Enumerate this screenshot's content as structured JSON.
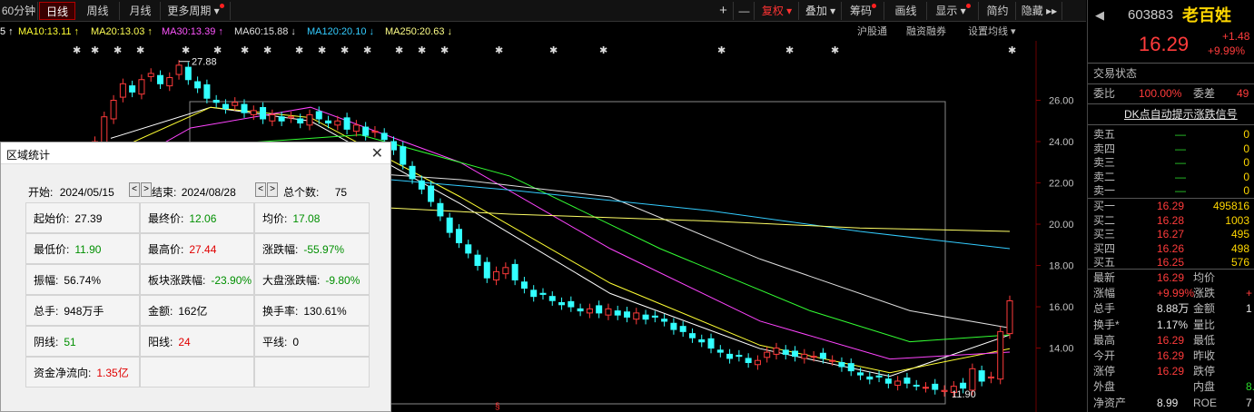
{
  "toolbar": {
    "left": [
      {
        "label": "60分钟",
        "active": false
      },
      {
        "label": "日线",
        "active": true
      },
      {
        "label": "周线",
        "active": false
      },
      {
        "label": "月线",
        "active": false
      },
      {
        "label": "更多周期 ▾",
        "active": false
      }
    ],
    "right": [
      {
        "label": "+",
        "dot": false,
        "red": false
      },
      {
        "label": "—",
        "dot": false,
        "red": false
      },
      {
        "label": "复权 ▾",
        "dot": false,
        "red": true
      },
      {
        "label": "叠加 ▾",
        "dot": false,
        "red": false
      },
      {
        "label": "筹码",
        "dot": true,
        "red": false
      },
      {
        "label": "画线",
        "dot": false,
        "red": false
      },
      {
        "label": "显示 ▾",
        "dot": true,
        "red": false
      },
      {
        "label": "简约",
        "dot": false,
        "red": false
      },
      {
        "label": "隐藏 ▸▸",
        "dot": false,
        "red": false
      }
    ]
  },
  "ma": {
    "ma5": "5 ↑",
    "ma10": "MA10:13.11 ↑",
    "ma20": "MA20:13.03 ↑",
    "ma30": "MA30:13.39 ↑",
    "ma60": "MA60:15.88 ↓",
    "ma120": "MA120:20.10 ↓",
    "ma250": "MA250:20.63 ↓",
    "links": [
      "沪股通",
      "融资融券",
      "设置均线 ▾"
    ],
    "colors": {
      "ma5": "#ffffff",
      "ma10": "#ffff33",
      "ma20": "#ff44ff",
      "ma30": "#33ff33",
      "ma60": "#e0e0e0",
      "ma120": "#33ccff",
      "ma250": "#ffff66"
    }
  },
  "chart_data": {
    "type": "candlestick",
    "y_axis_ticks": [
      "26.00",
      "24.00",
      "22.00",
      "20.00",
      "18.00",
      "16.00",
      "14.00"
    ],
    "ylim": [
      11.3,
      28.0
    ],
    "annotations": {
      "high_label": "27.88",
      "low_label": "11.90"
    },
    "up_color": "#ff3b3b",
    "down_color": "#33ffff",
    "closes": [
      20.9,
      21.2,
      21.0,
      21.5,
      21.8,
      21.6,
      22.0,
      22.6,
      23.2,
      24.0,
      25.2,
      26.0,
      26.8,
      26.4,
      27.0,
      27.3,
      26.8,
      27.1,
      27.7,
      27.0,
      26.6,
      26.1,
      25.9,
      25.6,
      25.9,
      25.4,
      25.5,
      25.1,
      25.3,
      25.0,
      25.2,
      24.9,
      25.3,
      25.1,
      24.9,
      25.0,
      24.6,
      24.8,
      24.3,
      24.5,
      24.1,
      23.6,
      22.9,
      22.2,
      21.7,
      21.1,
      20.4,
      19.6,
      19.1,
      18.6,
      18.0,
      17.4,
      17.7,
      17.9,
      17.3,
      16.9,
      16.5,
      16.6,
      16.3,
      16.1,
      16.0,
      15.8,
      15.9,
      15.7,
      15.9,
      15.6,
      15.5,
      15.7,
      15.4,
      15.5,
      15.3,
      14.9,
      14.8,
      14.5,
      14.3,
      14.0,
      13.8,
      13.5,
      13.6,
      13.3,
      13.4,
      13.8,
      14.0,
      13.7,
      13.6,
      13.7,
      13.6,
      13.5,
      13.4,
      13.1,
      12.9,
      12.7,
      12.5,
      12.6,
      12.3,
      12.4,
      12.3,
      12.2,
      12.1,
      12.0,
      11.95,
      12.15,
      12.06,
      13.0,
      12.4,
      12.6,
      14.8,
      16.29
    ],
    "ma_lines": {
      "ma5": [
        [
          0.1,
          0.23
        ],
        [
          0.2,
          0.14
        ],
        [
          0.3,
          0.18
        ],
        [
          0.45,
          0.42
        ],
        [
          0.6,
          0.68
        ],
        [
          0.75,
          0.84
        ],
        [
          0.88,
          0.92
        ],
        [
          1.0,
          0.8
        ]
      ],
      "ma10": [
        [
          0.1,
          0.27
        ],
        [
          0.2,
          0.14
        ],
        [
          0.3,
          0.17
        ],
        [
          0.45,
          0.4
        ],
        [
          0.6,
          0.65
        ],
        [
          0.75,
          0.83
        ],
        [
          0.88,
          0.91
        ],
        [
          1.0,
          0.84
        ]
      ],
      "ma20": [
        [
          0.1,
          0.33
        ],
        [
          0.18,
          0.2
        ],
        [
          0.3,
          0.14
        ],
        [
          0.45,
          0.3
        ],
        [
          0.6,
          0.55
        ],
        [
          0.75,
          0.76
        ],
        [
          0.88,
          0.87
        ],
        [
          1.0,
          0.85
        ]
      ],
      "ma30": [
        [
          0.1,
          0.4
        ],
        [
          0.2,
          0.25
        ],
        [
          0.35,
          0.22
        ],
        [
          0.5,
          0.34
        ],
        [
          0.65,
          0.55
        ],
        [
          0.8,
          0.73
        ],
        [
          0.9,
          0.82
        ],
        [
          1.0,
          0.8
        ]
      ],
      "ma60": [
        [
          0.3,
          0.32
        ],
        [
          0.45,
          0.35
        ],
        [
          0.6,
          0.4
        ],
        [
          0.75,
          0.58
        ],
        [
          0.9,
          0.73
        ],
        [
          1.0,
          0.78
        ]
      ],
      "ma120": [
        [
          0.3,
          0.33
        ],
        [
          0.5,
          0.38
        ],
        [
          0.7,
          0.44
        ],
        [
          0.85,
          0.5
        ],
        [
          1.0,
          0.55
        ]
      ],
      "ma250": [
        [
          0.3,
          0.42
        ],
        [
          0.5,
          0.45
        ],
        [
          0.7,
          0.47
        ],
        [
          0.85,
          0.49
        ],
        [
          1.0,
          0.5
        ]
      ]
    }
  },
  "quote": {
    "code": "603883",
    "name": "老百姓",
    "price": "16.29",
    "change": "+1.48",
    "change_pct": "+9.99%",
    "status_label": "交易状态",
    "weibi_label": "委比",
    "weibi_value": "100.00%",
    "weicha_label": "委差",
    "weicha_value": "49",
    "dk_signal": "DK点自动提示涨跌信号",
    "asks": [
      {
        "label": "卖五",
        "price": "—",
        "vol": "0"
      },
      {
        "label": "卖四",
        "price": "—",
        "vol": "0"
      },
      {
        "label": "卖三",
        "price": "—",
        "vol": "0"
      },
      {
        "label": "卖二",
        "price": "—",
        "vol": "0"
      },
      {
        "label": "卖一",
        "price": "—",
        "vol": "0"
      }
    ],
    "bids": [
      {
        "label": "买一",
        "price": "16.29",
        "vol": "495816"
      },
      {
        "label": "买二",
        "price": "16.28",
        "vol": "1003"
      },
      {
        "label": "买三",
        "price": "16.27",
        "vol": "495"
      },
      {
        "label": "买四",
        "price": "16.26",
        "vol": "498"
      },
      {
        "label": "买五",
        "price": "16.25",
        "vol": "576"
      }
    ],
    "stats": [
      {
        "l1": "最新",
        "v1": "16.29",
        "c1": "up",
        "l2": "均价",
        "v2": "",
        "c2": "wh"
      },
      {
        "l1": "涨幅",
        "v1": "+9.99%",
        "c1": "up",
        "l2": "涨跌",
        "v2": "+",
        "c2": "up"
      },
      {
        "l1": "总手",
        "v1": "8.88万",
        "c1": "wh",
        "l2": "金额",
        "v2": "1",
        "c2": "wh"
      },
      {
        "l1": "换手*",
        "v1": "1.17%",
        "c1": "wh",
        "l2": "量比",
        "v2": "",
        "c2": "wh"
      },
      {
        "l1": "最高",
        "v1": "16.29",
        "c1": "up",
        "l2": "最低",
        "v2": "",
        "c2": "wh"
      },
      {
        "l1": "今开",
        "v1": "16.29",
        "c1": "up",
        "l2": "昨收",
        "v2": "",
        "c2": "wh"
      },
      {
        "l1": "涨停",
        "v1": "16.29",
        "c1": "up",
        "l2": "跌停",
        "v2": "",
        "c2": "wh"
      },
      {
        "l1": "外盘",
        "v1": "",
        "c1": "up",
        "l2": "内盘",
        "v2": "8.",
        "c2": "dn"
      },
      {
        "l1": "净资产",
        "v1": "8.99",
        "c1": "wh",
        "l2": "ROE",
        "v2": "7",
        "c2": "wh"
      }
    ]
  },
  "dialog": {
    "title": "区域统计",
    "start_label": "开始:",
    "start_date": "2024/05/15",
    "end_label": "结束:",
    "end_date": "2024/08/28",
    "count_label": "总个数:",
    "count": "75",
    "cells": [
      [
        {
          "l": "起始价:",
          "v": "27.39",
          "c": ""
        },
        {
          "l": "最终价:",
          "v": "12.06",
          "c": "dn"
        },
        {
          "l": "均价:",
          "v": "17.08",
          "c": "dn"
        }
      ],
      [
        {
          "l": "最低价:",
          "v": "11.90",
          "c": "dn"
        },
        {
          "l": "最高价:",
          "v": "27.44",
          "c": "up"
        },
        {
          "l": "涨跌幅:",
          "v": "-55.97%",
          "c": "dn"
        }
      ],
      [
        {
          "l": "振幅:",
          "v": "56.74%",
          "c": ""
        },
        {
          "l": "板块涨跌幅:",
          "v": "-23.90%",
          "c": "dn"
        },
        {
          "l": "大盘涨跌幅:",
          "v": "-9.80%",
          "c": "dn"
        }
      ],
      [
        {
          "l": "总手:",
          "v": "948万手",
          "c": ""
        },
        {
          "l": "金额:",
          "v": "162亿",
          "c": ""
        },
        {
          "l": "换手率:",
          "v": "130.61%",
          "c": ""
        }
      ],
      [
        {
          "l": "阴线:",
          "v": "51",
          "c": "dn"
        },
        {
          "l": "阳线:",
          "v": "24",
          "c": "up"
        },
        {
          "l": "平线:",
          "v": "0",
          "c": ""
        }
      ],
      [
        {
          "l": "资金净流向:",
          "v": "1.35亿",
          "c": "up"
        },
        {
          "l": "",
          "v": "",
          "c": ""
        },
        {
          "l": "",
          "v": "",
          "c": ""
        }
      ]
    ]
  }
}
